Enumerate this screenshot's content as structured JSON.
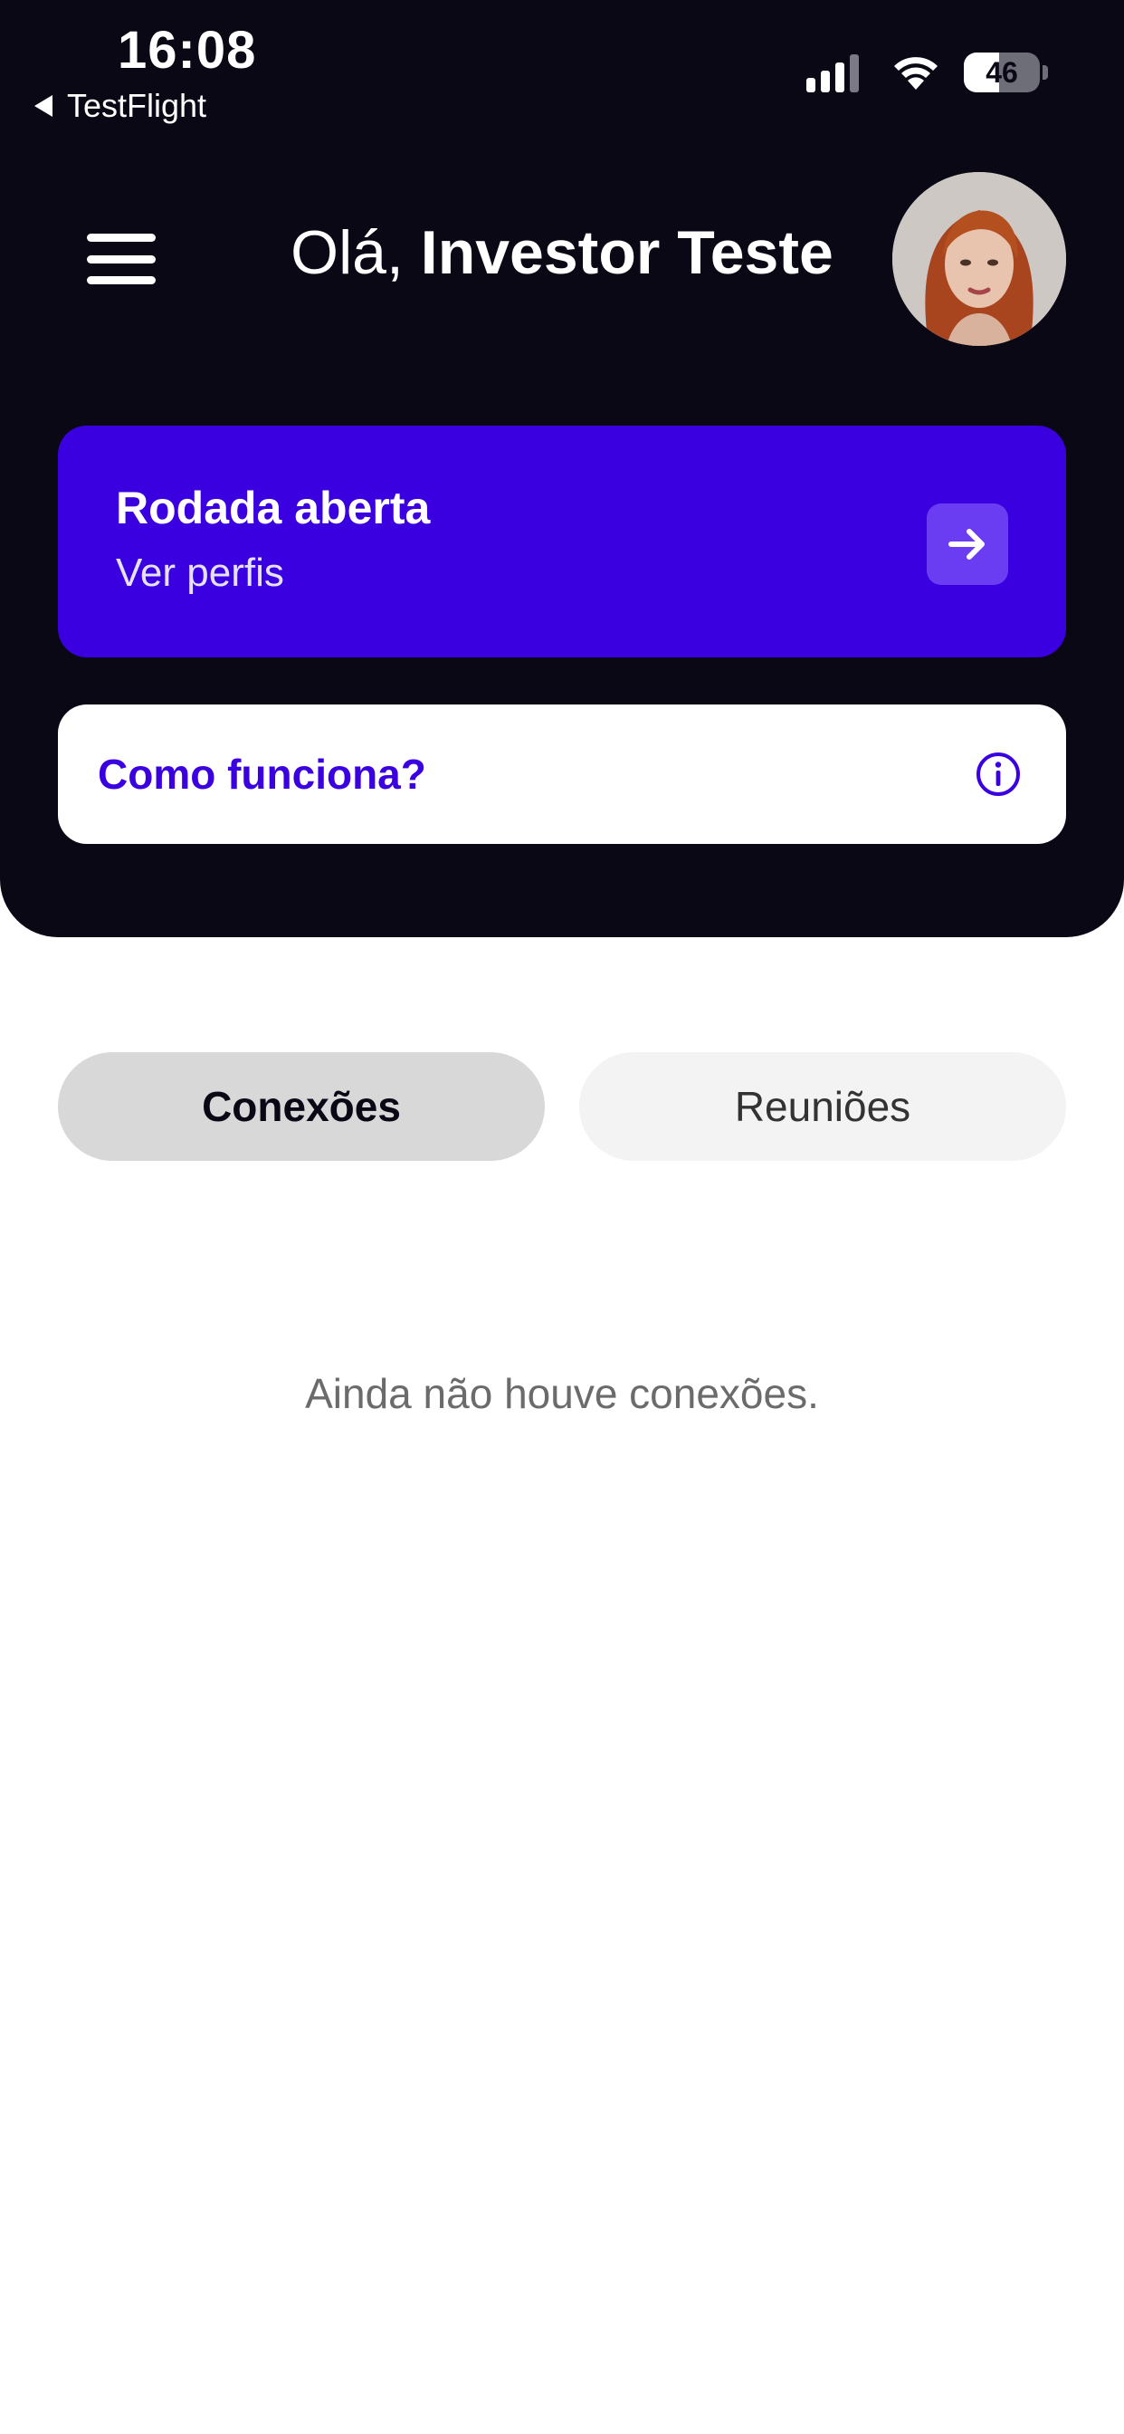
{
  "status_bar": {
    "time": "16:08",
    "back_app": "TestFlight",
    "battery": "46",
    "battery_level": 0.46
  },
  "header": {
    "greeting_prefix": "Olá,",
    "user_name": "Investor Teste"
  },
  "round_card": {
    "title": "Rodada aberta",
    "subtitle": "Ver perfis",
    "icon": "arrow-right-icon"
  },
  "how_card": {
    "label": "Como funciona?",
    "icon": "info-icon"
  },
  "tabs": [
    {
      "label": "Conexões",
      "active": true
    },
    {
      "label": "Reuniões",
      "active": false
    }
  ],
  "empty_state": {
    "message": "Ainda não houve conexões."
  },
  "colors": {
    "header_bg": "#0b0816",
    "accent": "#3a00e0",
    "accent_light": "#6a3df2"
  }
}
